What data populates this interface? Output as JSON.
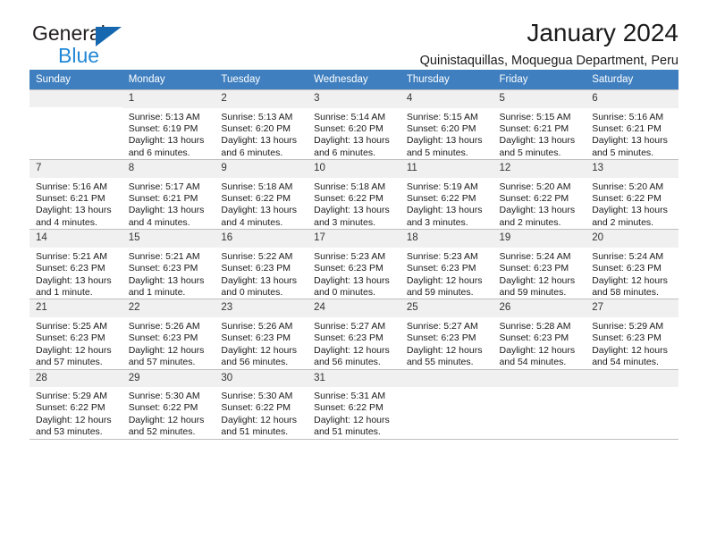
{
  "brand": {
    "line1": "General",
    "line2": "Blue",
    "triangle_color": "#1568b0",
    "blue_text_color": "#2288d6"
  },
  "header": {
    "month_title": "January 2024",
    "location": "Quinistaquillas, Moquegua Department, Peru"
  },
  "colors": {
    "header_row_bg": "#3f7fbf",
    "header_row_text": "#ffffff",
    "daynum_bg": "#f0f0f0",
    "cell_border": "#bfbfbf"
  },
  "calendar": {
    "weekday_headers": [
      "Sunday",
      "Monday",
      "Tuesday",
      "Wednesday",
      "Thursday",
      "Friday",
      "Saturday"
    ],
    "weeks": [
      [
        {
          "day": "",
          "sunrise": "",
          "sunset": "",
          "daylight": ""
        },
        {
          "day": "1",
          "sunrise": "Sunrise: 5:13 AM",
          "sunset": "Sunset: 6:19 PM",
          "daylight": "Daylight: 13 hours and 6 minutes."
        },
        {
          "day": "2",
          "sunrise": "Sunrise: 5:13 AM",
          "sunset": "Sunset: 6:20 PM",
          "daylight": "Daylight: 13 hours and 6 minutes."
        },
        {
          "day": "3",
          "sunrise": "Sunrise: 5:14 AM",
          "sunset": "Sunset: 6:20 PM",
          "daylight": "Daylight: 13 hours and 6 minutes."
        },
        {
          "day": "4",
          "sunrise": "Sunrise: 5:15 AM",
          "sunset": "Sunset: 6:20 PM",
          "daylight": "Daylight: 13 hours and 5 minutes."
        },
        {
          "day": "5",
          "sunrise": "Sunrise: 5:15 AM",
          "sunset": "Sunset: 6:21 PM",
          "daylight": "Daylight: 13 hours and 5 minutes."
        },
        {
          "day": "6",
          "sunrise": "Sunrise: 5:16 AM",
          "sunset": "Sunset: 6:21 PM",
          "daylight": "Daylight: 13 hours and 5 minutes."
        }
      ],
      [
        {
          "day": "7",
          "sunrise": "Sunrise: 5:16 AM",
          "sunset": "Sunset: 6:21 PM",
          "daylight": "Daylight: 13 hours and 4 minutes."
        },
        {
          "day": "8",
          "sunrise": "Sunrise: 5:17 AM",
          "sunset": "Sunset: 6:21 PM",
          "daylight": "Daylight: 13 hours and 4 minutes."
        },
        {
          "day": "9",
          "sunrise": "Sunrise: 5:18 AM",
          "sunset": "Sunset: 6:22 PM",
          "daylight": "Daylight: 13 hours and 4 minutes."
        },
        {
          "day": "10",
          "sunrise": "Sunrise: 5:18 AM",
          "sunset": "Sunset: 6:22 PM",
          "daylight": "Daylight: 13 hours and 3 minutes."
        },
        {
          "day": "11",
          "sunrise": "Sunrise: 5:19 AM",
          "sunset": "Sunset: 6:22 PM",
          "daylight": "Daylight: 13 hours and 3 minutes."
        },
        {
          "day": "12",
          "sunrise": "Sunrise: 5:20 AM",
          "sunset": "Sunset: 6:22 PM",
          "daylight": "Daylight: 13 hours and 2 minutes."
        },
        {
          "day": "13",
          "sunrise": "Sunrise: 5:20 AM",
          "sunset": "Sunset: 6:22 PM",
          "daylight": "Daylight: 13 hours and 2 minutes."
        }
      ],
      [
        {
          "day": "14",
          "sunrise": "Sunrise: 5:21 AM",
          "sunset": "Sunset: 6:23 PM",
          "daylight": "Daylight: 13 hours and 1 minute."
        },
        {
          "day": "15",
          "sunrise": "Sunrise: 5:21 AM",
          "sunset": "Sunset: 6:23 PM",
          "daylight": "Daylight: 13 hours and 1 minute."
        },
        {
          "day": "16",
          "sunrise": "Sunrise: 5:22 AM",
          "sunset": "Sunset: 6:23 PM",
          "daylight": "Daylight: 13 hours and 0 minutes."
        },
        {
          "day": "17",
          "sunrise": "Sunrise: 5:23 AM",
          "sunset": "Sunset: 6:23 PM",
          "daylight": "Daylight: 13 hours and 0 minutes."
        },
        {
          "day": "18",
          "sunrise": "Sunrise: 5:23 AM",
          "sunset": "Sunset: 6:23 PM",
          "daylight": "Daylight: 12 hours and 59 minutes."
        },
        {
          "day": "19",
          "sunrise": "Sunrise: 5:24 AM",
          "sunset": "Sunset: 6:23 PM",
          "daylight": "Daylight: 12 hours and 59 minutes."
        },
        {
          "day": "20",
          "sunrise": "Sunrise: 5:24 AM",
          "sunset": "Sunset: 6:23 PM",
          "daylight": "Daylight: 12 hours and 58 minutes."
        }
      ],
      [
        {
          "day": "21",
          "sunrise": "Sunrise: 5:25 AM",
          "sunset": "Sunset: 6:23 PM",
          "daylight": "Daylight: 12 hours and 57 minutes."
        },
        {
          "day": "22",
          "sunrise": "Sunrise: 5:26 AM",
          "sunset": "Sunset: 6:23 PM",
          "daylight": "Daylight: 12 hours and 57 minutes."
        },
        {
          "day": "23",
          "sunrise": "Sunrise: 5:26 AM",
          "sunset": "Sunset: 6:23 PM",
          "daylight": "Daylight: 12 hours and 56 minutes."
        },
        {
          "day": "24",
          "sunrise": "Sunrise: 5:27 AM",
          "sunset": "Sunset: 6:23 PM",
          "daylight": "Daylight: 12 hours and 56 minutes."
        },
        {
          "day": "25",
          "sunrise": "Sunrise: 5:27 AM",
          "sunset": "Sunset: 6:23 PM",
          "daylight": "Daylight: 12 hours and 55 minutes."
        },
        {
          "day": "26",
          "sunrise": "Sunrise: 5:28 AM",
          "sunset": "Sunset: 6:23 PM",
          "daylight": "Daylight: 12 hours and 54 minutes."
        },
        {
          "day": "27",
          "sunrise": "Sunrise: 5:29 AM",
          "sunset": "Sunset: 6:23 PM",
          "daylight": "Daylight: 12 hours and 54 minutes."
        }
      ],
      [
        {
          "day": "28",
          "sunrise": "Sunrise: 5:29 AM",
          "sunset": "Sunset: 6:22 PM",
          "daylight": "Daylight: 12 hours and 53 minutes."
        },
        {
          "day": "29",
          "sunrise": "Sunrise: 5:30 AM",
          "sunset": "Sunset: 6:22 PM",
          "daylight": "Daylight: 12 hours and 52 minutes."
        },
        {
          "day": "30",
          "sunrise": "Sunrise: 5:30 AM",
          "sunset": "Sunset: 6:22 PM",
          "daylight": "Daylight: 12 hours and 51 minutes."
        },
        {
          "day": "31",
          "sunrise": "Sunrise: 5:31 AM",
          "sunset": "Sunset: 6:22 PM",
          "daylight": "Daylight: 12 hours and 51 minutes."
        },
        {
          "day": "",
          "sunrise": "",
          "sunset": "",
          "daylight": ""
        },
        {
          "day": "",
          "sunrise": "",
          "sunset": "",
          "daylight": ""
        },
        {
          "day": "",
          "sunrise": "",
          "sunset": "",
          "daylight": ""
        }
      ]
    ]
  }
}
